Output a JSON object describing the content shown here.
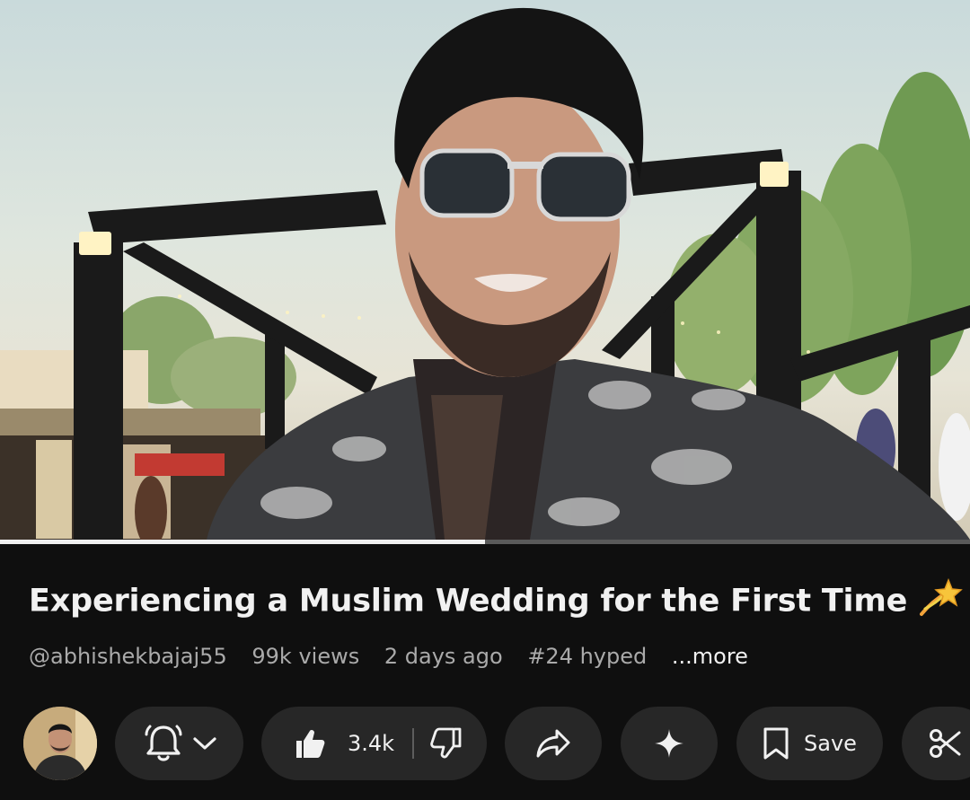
{
  "video": {
    "scene": "vlog-selfie-wedding-venue",
    "progress": 0.5
  },
  "title": {
    "text": "Experiencing a Muslim Wedding for the First Time",
    "emoji": "dizzy-star-emoji"
  },
  "meta": {
    "channel": "@abhishekbajaj55",
    "views": "99k views",
    "age": "2 days ago",
    "hype": "#24 hyped",
    "more": "...more"
  },
  "actions": {
    "subscribe_icon": "bell-icon",
    "likes": "3.4k",
    "save_label": "Save",
    "icons": [
      "like-icon",
      "dislike-icon",
      "share-icon",
      "ask-sparkle-icon",
      "bookmark-icon",
      "scissors-icon"
    ]
  },
  "colors": {
    "background": "#0f0f0f",
    "pill": "#272727",
    "text_primary": "#f1f1f1",
    "text_secondary": "#aaaaaa",
    "progress_track": "#5a5a5a",
    "progress_fill": "#f1f1f1"
  }
}
